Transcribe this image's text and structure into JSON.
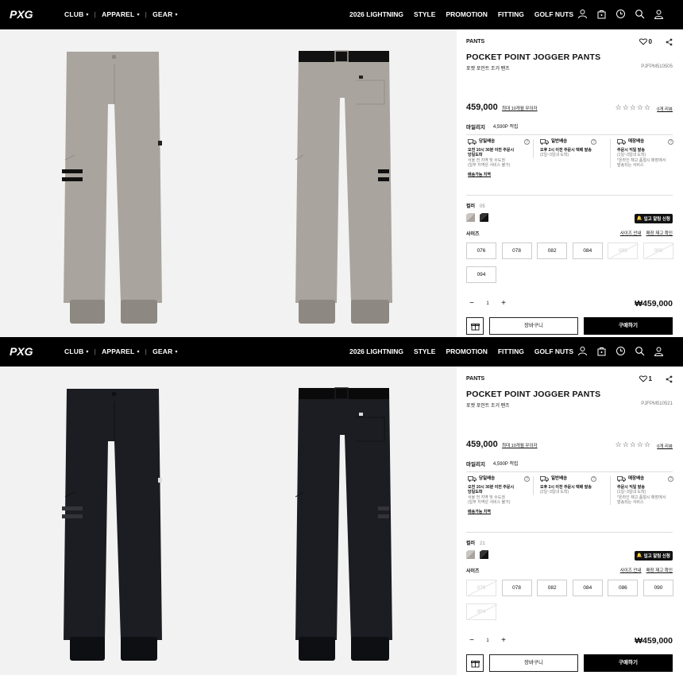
{
  "nav": {
    "left": [
      {
        "label": "CLUB",
        "separator": "|"
      },
      {
        "label": "APPAREL",
        "separator": "|"
      },
      {
        "label": "GEAR",
        "separator": ""
      }
    ],
    "right": [
      "2026 LIGHTNING",
      "STYLE",
      "PROMOTION",
      "FITTING",
      "GOLF NUTS"
    ],
    "icons": [
      "user-icon",
      "bag-icon",
      "history-icon",
      "search-icon",
      "account-icon"
    ]
  },
  "panels": [
    {
      "variant": "gray",
      "colors": {
        "pants": "#aaa49e",
        "pants_dark": "#8d8882",
        "belt": "#111111",
        "stripe": "#111111",
        "gallery_bg": "#f2f2f2"
      },
      "category": "PANTS",
      "likes": "0",
      "title": "POCKET POINT JOGGER PANTS",
      "title_kr": "포켓 포인트 조거 팬츠",
      "code": "PJFPM510505",
      "price": "459,000",
      "coupon": "최대 10개월 무이자",
      "stars": "☆☆☆☆☆",
      "reviews": "0개 리뷰",
      "mileage_label": "마일리지",
      "mileage_value": "4,590P 적립",
      "shipping": [
        {
          "title": "당일배송",
          "line1": "오전 10시 30분 이전 주문시",
          "line2": "당일도착",
          "line3": "서울 전 지역 및 수도권",
          "line4": "(일부 지역은 서비스 불가)",
          "link": "배송가능 지역"
        },
        {
          "title": "일반배송",
          "line1": "오후 2시 이전 주문시 택배 발송",
          "line2": "(2일~3일내 도착)",
          "line3": "",
          "line4": "",
          "link": ""
        },
        {
          "title": "매장배송",
          "line1": "주문시 익일 발송",
          "line2": "(1일~3일내 도착)",
          "line3": "*온라인 재고 품절시 매장에서",
          "line4": "발송되는 서비스",
          "link": ""
        }
      ],
      "color_label": "컬러",
      "color_code": "05",
      "restock": "입고 알림 신청",
      "size_label": "사이즈",
      "size_links": [
        "사이즈 안내",
        "매장 재고 확인"
      ],
      "sizes": [
        {
          "label": "076",
          "disabled": false
        },
        {
          "label": "078",
          "disabled": false
        },
        {
          "label": "082",
          "disabled": false
        },
        {
          "label": "084",
          "disabled": false
        },
        {
          "label": "086",
          "disabled": true
        },
        {
          "label": "090",
          "disabled": true
        },
        {
          "label": "094",
          "disabled": false
        }
      ],
      "qty": "1",
      "minus": "−",
      "plus": "+",
      "total": "₩459,000",
      "cart": "장바구니",
      "buy": "구매하기"
    },
    {
      "variant": "black",
      "colors": {
        "pants": "#1c1d22",
        "pants_dark": "#0e0f12",
        "belt": "#0a0a0a",
        "stripe": "#333339",
        "gallery_bg": "#f2f2f2"
      },
      "category": "PANTS",
      "likes": "1",
      "title": "POCKET POINT JOGGER PANTS",
      "title_kr": "포켓 포인트 조거 팬츠",
      "code": "PJFPM510521",
      "price": "459,000",
      "coupon": "최대 10개월 무이자",
      "stars": "☆☆☆☆☆",
      "reviews": "0개 리뷰",
      "mileage_label": "마일리지",
      "mileage_value": "4,590P 적립",
      "shipping": [
        {
          "title": "당일배송",
          "line1": "오전 10시 30분 이전 주문시",
          "line2": "당일도착",
          "line3": "서울 전 지역 및 수도권",
          "line4": "(일부 지역은 서비스 불가)",
          "link": "배송가능 지역"
        },
        {
          "title": "일반배송",
          "line1": "오후 2시 이전 주문시 택배 발송",
          "line2": "(2일~3일내 도착)",
          "line3": "",
          "line4": "",
          "link": ""
        },
        {
          "title": "매장배송",
          "line1": "주문시 익일 발송",
          "line2": "(1일~3일내 도착)",
          "line3": "*온라인 재고 품절시 매장에서",
          "line4": "발송되는 서비스",
          "link": ""
        }
      ],
      "color_label": "컬러",
      "color_code": "21",
      "restock": "입고 알림 신청",
      "size_label": "사이즈",
      "size_links": [
        "사이즈 안내",
        "매장 재고 확인"
      ],
      "sizes": [
        {
          "label": "076",
          "disabled": true
        },
        {
          "label": "078",
          "disabled": false
        },
        {
          "label": "082",
          "disabled": false
        },
        {
          "label": "084",
          "disabled": false
        },
        {
          "label": "086",
          "disabled": false
        },
        {
          "label": "090",
          "disabled": false
        },
        {
          "label": "094",
          "disabled": true
        }
      ],
      "qty": "1",
      "minus": "−",
      "plus": "+",
      "total": "₩459,000",
      "cart": "장바구니",
      "buy": "구매하기"
    }
  ]
}
